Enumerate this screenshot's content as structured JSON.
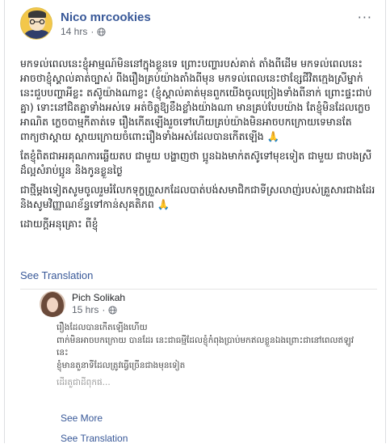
{
  "post": {
    "author": "Nico mrcookies",
    "time": "14 hrs",
    "separator": "·",
    "privacy_icon": "globe-icon",
    "more_icon": "···",
    "paragraphs": [
      "មកទល់ពេលនេះខ្ញុំអាម្មណ៍មិននៅក្នុងខ្លួនទេ ព្រោះបញ្ហារបស់គាត់ តាំងពីដើម មកទល់ពេលនេះអាចថាខ្ញុំស្គាល់គាត់ច្បាស់ ពីងរឿងគ្រប់យ៉ាងតាំងពីមុន មកទល់ពេលនេះថាខ្សែជីវិតក្មេងស្រីម្នាក់នេះជួបបញ្ហាអីខ្លះ តស៊ូយ៉ាងណាខ្លះ (ខ្ញុំស្គាល់គាត់មុនពួកយើងចូលច្រៀងទាំងពីនាក់ ព្រោះផ្ទះជាប់គ្នា) ទោះនៅជិតគ្នាទាំងអស់ទេ អត់ចិត្តឱ្យខឹងខ្លាំងយ៉ាងណា មានគ្រប់បែបយ៉ាង តែខ្ញុំមិនដែលក្លេចអាណិត ក្លេចបាម្មកីតាត់ទេ រឿងកើតឡើងរួចទៅហើយគ្រប់យ៉ាងមិនអាចបកក្រោយទេមានតែពាក្យថាស្តាយ ស្តាយក្រោយចំពោះរឿងទាំងអស់ដែលបានកើតឡើង",
      "តែខ្ញុំពិតជាអរគុណការឆ្លើយតប ជាមួយ បង្ហាញថា ប្អូនឯងមាក់តស៊ូទៅមុខទៀត ជាមួយ ជាបងស្រីដ៏ល្អសំរាប់ប្អូន និងកូនខ្លួនថ្ងៃ",
      "ជាថ្មីម្តងទៀតសូមចូលរួមរំលែកទុក្ខព្រួសកដែលបាត់បង់សមាជិកជាទីស្រលាញ់របស់គ្រួសារជាងដែរ និងសូមវិញ្ញាណខ័ន្ធទៅកាន់សុគតិភព",
      "ដោយក្តីអនុគ្រោះ ពីខ្ញុំ"
    ],
    "pray_emoji": "🙏",
    "see_translation": "See Translation"
  },
  "comment": {
    "author": "Pich Solikah",
    "time": "15 hrs",
    "separator": "·",
    "privacy_icon": "globe-icon",
    "paragraphs": [
      "រឿងដែលបានកើតឡើងហើយ\nពាក់មិនអាចបកក្រោយ បានដែរ នេះជាធម្មីដែលខ្ញុំកំពុងប្រាប់មកឥលខ្លួនឯងព្រោះជានៅពេលឥឡូវនេះ\nខ្ញុំមានតួនាទីដែលត្រូវធ្វើច្រើនជាងមុនទៀត",
      "ដើរតួជាដីពុកផ..."
    ],
    "see_more": "See More",
    "see_translation": "See Translation"
  }
}
